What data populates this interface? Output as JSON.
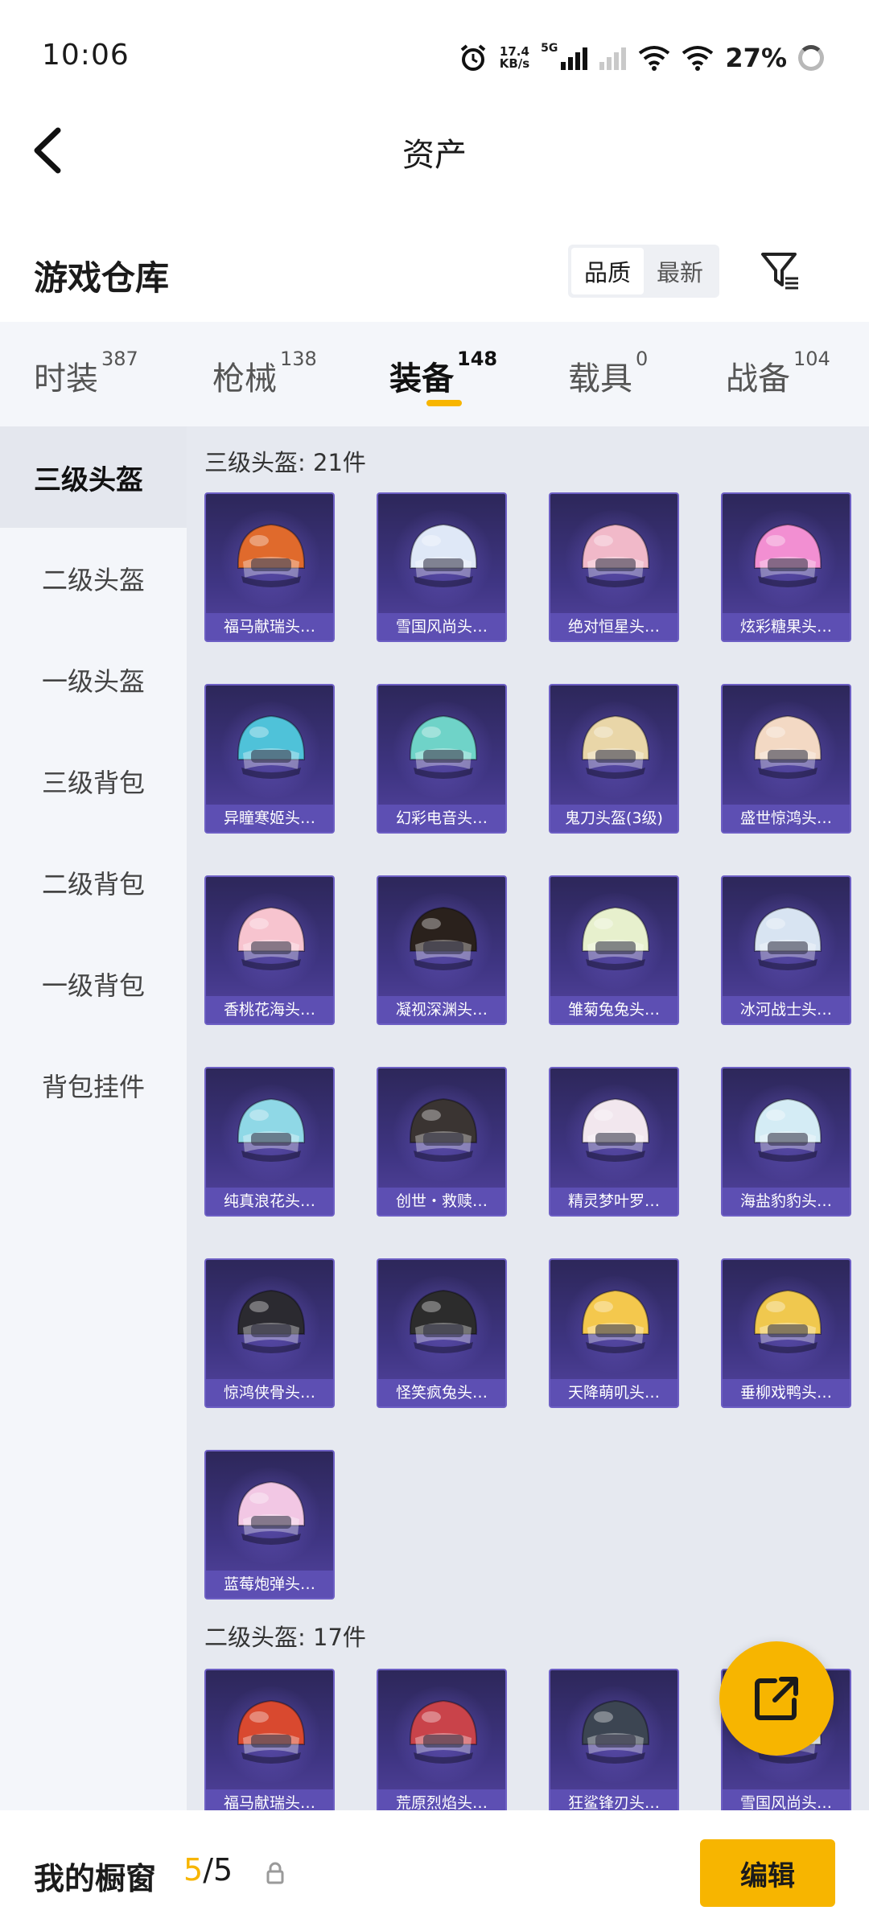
{
  "status_bar": {
    "time": "10:06",
    "speed_value": "17.4",
    "speed_unit": "KB/s",
    "network": "5G",
    "battery": "27%",
    "icons": [
      "alarm-icon",
      "signal-icon",
      "wifi-icon",
      "battery-ring-icon"
    ]
  },
  "header": {
    "title": "资产",
    "back_icon": "chevron-left-icon"
  },
  "warehouse": {
    "title": "游戏仓库",
    "sort_options": [
      "品质",
      "最新"
    ],
    "sort_selected": "品质",
    "filter_icon": "filter-icon"
  },
  "tabs": [
    {
      "label": "时装",
      "count": "387"
    },
    {
      "label": "枪械",
      "count": "138"
    },
    {
      "label": "装备",
      "count": "148",
      "active": true
    },
    {
      "label": "载具",
      "count": "0"
    },
    {
      "label": "战备",
      "count": "104"
    }
  ],
  "sidebar": {
    "items": [
      "三级头盔",
      "二级头盔",
      "一级头盔",
      "三级背包",
      "二级背包",
      "一级背包",
      "背包挂件"
    ],
    "selected": "三级头盔"
  },
  "sections": [
    {
      "header": "三级头盔: 21件",
      "items": [
        {
          "name": "福马献瑞头…",
          "color": "#e06a2c"
        },
        {
          "name": "雪国风尚头…",
          "color": "#dfe8f7"
        },
        {
          "name": "绝对恒星头…",
          "color": "#f1b9c9"
        },
        {
          "name": "炫彩糖果头…",
          "color": "#f28fd2"
        },
        {
          "name": "异瞳寒姬头…",
          "color": "#4fc2d9"
        },
        {
          "name": "幻彩电音头…",
          "color": "#6fd3c8"
        },
        {
          "name": "鬼刀头盔(3级)",
          "color": "#e9d6a8"
        },
        {
          "name": "盛世惊鸿头…",
          "color": "#f3d9c4"
        },
        {
          "name": "香桃花海头…",
          "color": "#f7c4cf"
        },
        {
          "name": "凝视深渊头…",
          "color": "#2a211c"
        },
        {
          "name": "雏菊兔兔头…",
          "color": "#e7f0cd"
        },
        {
          "name": "冰河战士头…",
          "color": "#d8e4f2"
        },
        {
          "name": "纯真浪花头…",
          "color": "#8fd8e6"
        },
        {
          "name": "创世・救赎…",
          "color": "#3a3432"
        },
        {
          "name": "精灵梦叶罗…",
          "color": "#f2e7ee"
        },
        {
          "name": "海盐豹豹头…",
          "color": "#d4ecf5"
        },
        {
          "name": "惊鸿侠骨头…",
          "color": "#2b2a30"
        },
        {
          "name": "怪笑疯兔头…",
          "color": "#2c2c2c"
        },
        {
          "name": "天降萌叽头…",
          "color": "#f4c84d"
        },
        {
          "name": "垂柳戏鸭头…",
          "color": "#f0c84e"
        },
        {
          "name": "蓝莓炮弹头…",
          "color": "#f2c7e4"
        }
      ]
    },
    {
      "header": "二级头盔: 17件",
      "items": [
        {
          "name": "福马献瑞头…",
          "color": "#d9492f"
        },
        {
          "name": "荒原烈焰头…",
          "color": "#c9434a"
        },
        {
          "name": "狂鲨锋刃头…",
          "color": "#3c4552"
        },
        {
          "name": "雪国风尚头…",
          "color": "#e9eef5"
        }
      ]
    }
  ],
  "fab": {
    "icon": "share-external-icon"
  },
  "bottom_bar": {
    "title": "我的橱窗",
    "count_current": "5",
    "count_sep": "/",
    "count_total": "5",
    "lock_icon": "lock-icon",
    "edit_label": "编辑"
  },
  "colors": {
    "accent": "#f7b500",
    "card_bg": "#3f3583",
    "card_label": "#5d4fb3"
  }
}
